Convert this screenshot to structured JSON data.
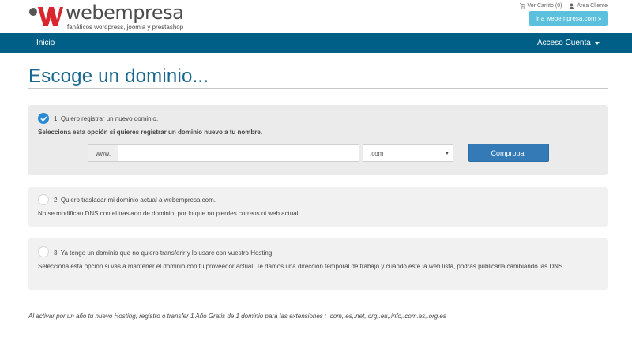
{
  "header": {
    "logo_text": "webempresa",
    "logo_tagline": "fanáticos wordpress, joomla y prestashop",
    "cart_label": "Ver Carrito (0)",
    "client_area_label": "Área Cliente",
    "go_button_label": "Ir a webempresa.com »",
    "colors": {
      "logo_red": "#d9262e",
      "go_button": "#5bc0de"
    }
  },
  "navbar": {
    "home_label": "Inicio",
    "account_label": "Acceso Cuenta",
    "color": "#005f87"
  },
  "page": {
    "title": "Escoge un dominio..."
  },
  "options": [
    {
      "title": "1. Quiero registrar un nuevo dominio.",
      "description": "Selecciona esta opción si quieres registrar un dominio nuevo a tu nombre.",
      "selected": true
    },
    {
      "title": "2. Quiero trasladar mi dominio actual a webempresa.com.",
      "description": "No se modifican DNS con el traslado de dominio, por lo que no pierdes correos ni web actual.",
      "selected": false
    },
    {
      "title": "3. Ya tengo un dominio que no quiero transferir y lo usaré con vuestro Hosting.",
      "description": "Selecciona esta opción si vas a mantener el dominio con tu proveedor actual. Te damos una dirección temporal de trabajo y cuando esté la web lista, podrás publicarla cambiando las DNS.",
      "selected": false
    }
  ],
  "search": {
    "prefix": "www.",
    "domain_value": "",
    "tld_selected": ".com",
    "check_button_label": "Comprobar",
    "button_color": "#337ab7"
  },
  "footnote": "Al activar por un año tu nuevo Hosting, registro o transfer 1 Año Gratis de 1 dominio para las extensiones : .com,.es,.net,.org,.eu,.info,.com.es,.org.es",
  "icons": [
    "logo-mark-icon",
    "cart-icon",
    "user-icon",
    "caret-down-icon",
    "checkmark-icon",
    "chevron-down-icon"
  ]
}
